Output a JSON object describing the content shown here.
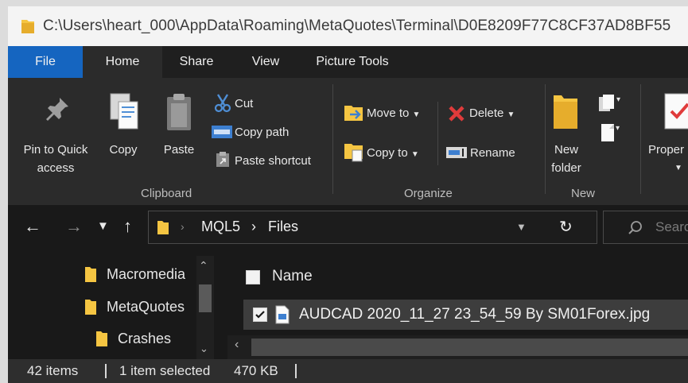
{
  "window": {
    "title_path": "C:\\Users\\heart_000\\AppData\\Roaming\\MetaQuotes\\Terminal\\D0E8209F77C8CF37AD8BF55"
  },
  "tabs": [
    {
      "label": "File"
    },
    {
      "label": "Home"
    },
    {
      "label": "Share"
    },
    {
      "label": "View"
    },
    {
      "label": "Picture Tools"
    }
  ],
  "ribbon": {
    "clipboard": {
      "pin_line1": "Pin to Quick",
      "pin_line2": "access",
      "copy": "Copy",
      "paste": "Paste",
      "cut": "Cut",
      "copy_path": "Copy path",
      "paste_shortcut": "Paste shortcut",
      "group": "Clipboard"
    },
    "organize": {
      "move_to": "Move to",
      "copy_to": "Copy to",
      "delete": "Delete",
      "rename": "Rename",
      "group": "Organize"
    },
    "new": {
      "new_folder_line1": "New",
      "new_folder_line2": "folder",
      "group": "New"
    },
    "open": {
      "properties": "Proper"
    }
  },
  "address": {
    "crumbs": [
      "MQL5",
      "Files"
    ],
    "search_placeholder": "Searc"
  },
  "nav": {
    "items": [
      {
        "label": "Macromedia"
      },
      {
        "label": "MetaQuotes"
      },
      {
        "label": "Crashes"
      }
    ]
  },
  "file_list": {
    "column_name": "Name",
    "rows": [
      {
        "name": "AUDCAD 2020_11_27 23_54_59 By SM01Forex.jpg",
        "selected": true
      }
    ]
  },
  "status": {
    "count": "42 items",
    "selection": "1 item selected",
    "size": "470 KB"
  },
  "colors": {
    "file_tab": "#1565c0",
    "folder": "#f5c542",
    "delete_x": "#e03b3b"
  }
}
